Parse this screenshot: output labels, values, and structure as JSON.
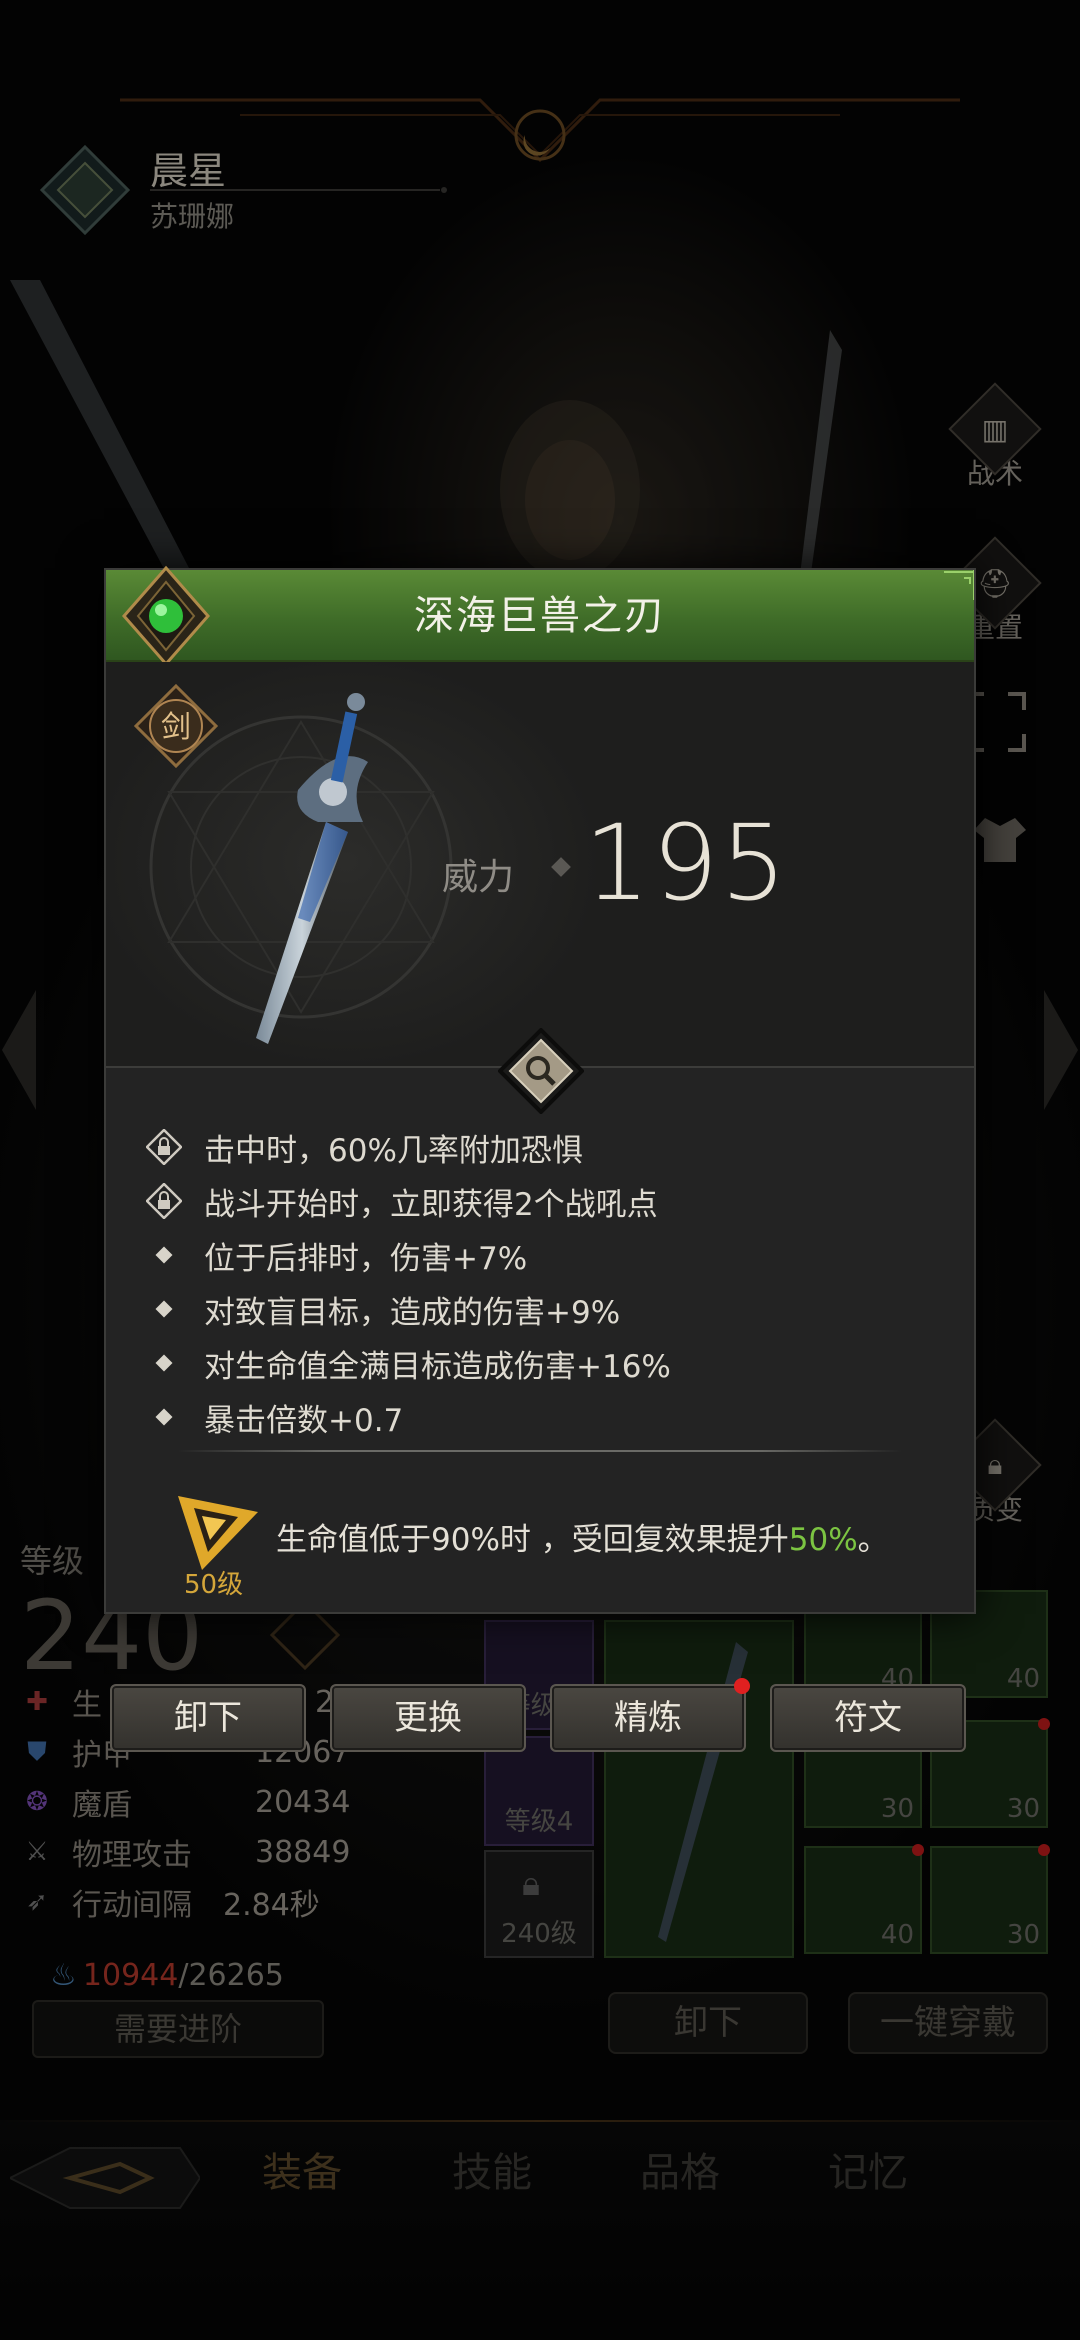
{
  "hero": {
    "name": "晨星",
    "subtitle": "苏珊娜"
  },
  "side_buttons": [
    {
      "label": "战术",
      "icon": "tactics-icon"
    },
    {
      "label": "重置",
      "icon": "reset-icon"
    },
    {
      "label": "",
      "icon": "focus-frame-icon"
    },
    {
      "label": "",
      "icon": "outfit-icon"
    }
  ],
  "transform_button": {
    "label": "质变"
  },
  "level": {
    "label": "等级",
    "value": "240"
  },
  "stats": [
    {
      "name": "生",
      "value": "2",
      "icon": "health-icon",
      "color": "#a33a3a"
    },
    {
      "name": "护甲",
      "value": "12067",
      "icon": "armor-icon",
      "color": "#3f6ea8"
    },
    {
      "name": "魔盾",
      "value": "20434",
      "icon": "magic-shield-icon",
      "color": "#8050b8"
    },
    {
      "name": "物理攻击",
      "value": "38849",
      "icon": "physical-attack-icon",
      "color": "#7a7a7a"
    },
    {
      "name": "行动间隔",
      "value": "2.84秒",
      "icon": "action-interval-icon",
      "color": "#7a7a7a"
    }
  ],
  "energy": {
    "current": "10944",
    "max": "/26265"
  },
  "need_advance_label": "需要进阶",
  "equipment_slots": {
    "rune_level_a": "等级3",
    "rune_level_b": "等级4",
    "locked_level": "240级",
    "numbers": [
      "40",
      "40",
      "30",
      "30",
      "40",
      "30"
    ]
  },
  "bottom_buttons": {
    "unequip": "卸下",
    "equip_all": "一键穿戴"
  },
  "nav_tabs": [
    {
      "label": "装备",
      "active": true
    },
    {
      "label": "技能",
      "active": false
    },
    {
      "label": "品格",
      "active": false
    },
    {
      "label": "记忆",
      "active": false
    }
  ],
  "item": {
    "name": "深海巨兽之刃",
    "type_badge": "剑",
    "power_label": "威力",
    "power_value": "195",
    "attributes": [
      {
        "text": "击中时，60%几率附加恐惧",
        "icon": "locked-attribute-icon"
      },
      {
        "text": "战斗开始时，立即获得2个战吼点",
        "icon": "locked-attribute-icon"
      },
      {
        "text": "位于后排时，伤害+7%",
        "icon": "diamond-bullet-icon"
      },
      {
        "text": "对致盲目标，造成的伤害+9%",
        "icon": "diamond-bullet-icon"
      },
      {
        "text": "对生命值全满目标造成伤害+16%",
        "icon": "diamond-bullet-icon"
      },
      {
        "text": "暴击倍数+0.7",
        "icon": "diamond-bullet-icon"
      }
    ],
    "passive": {
      "level": "50级",
      "text_before": "生命值低于90%时 ，受回复效果提升",
      "highlight": "50%",
      "text_after": "。"
    }
  },
  "actions": {
    "unequip": "卸下",
    "replace": "更换",
    "refine": "精炼",
    "rune": "符文"
  },
  "colors": {
    "header_green": "#4a7a2e",
    "accent_gold": "#d4a63a",
    "highlight_green": "#7cc442",
    "alert_red": "#e02020"
  }
}
